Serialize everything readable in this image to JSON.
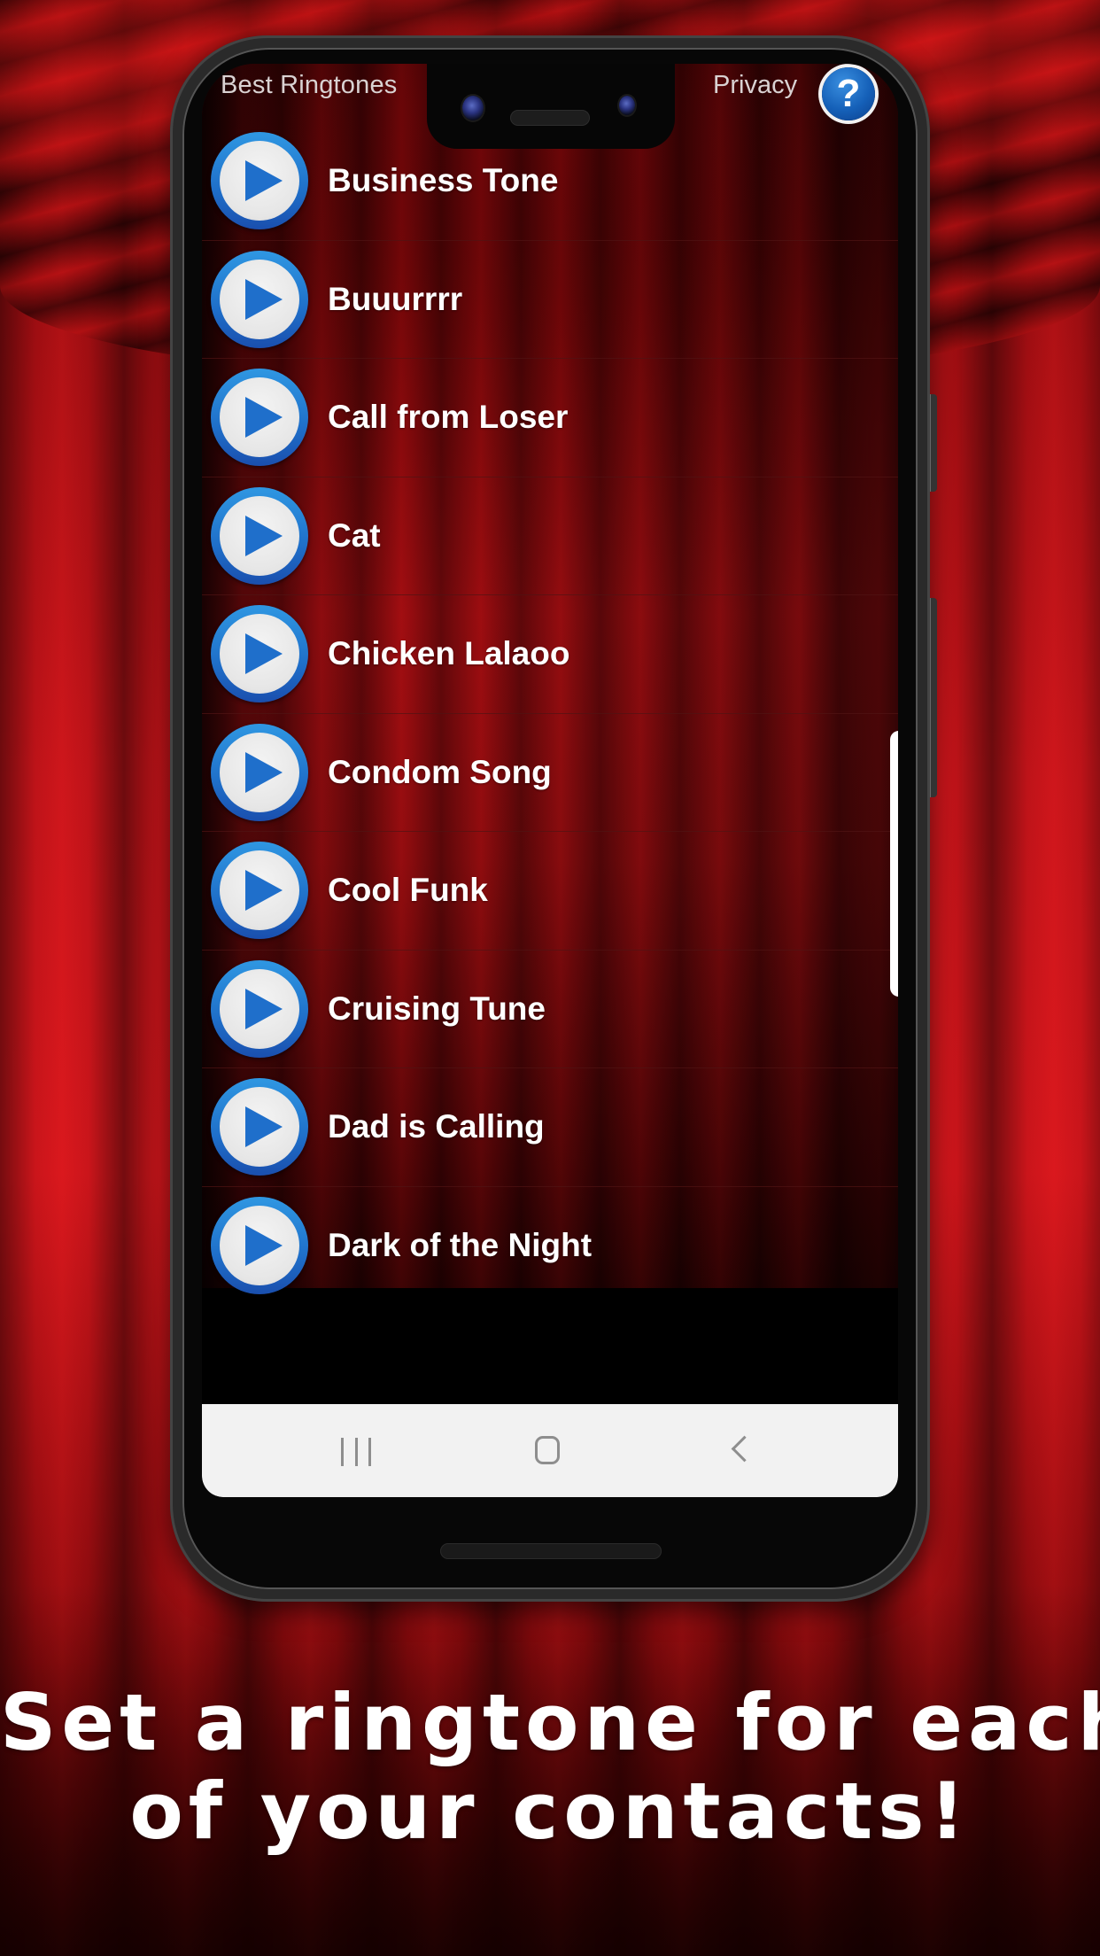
{
  "header": {
    "app_title": "Best Ringtones",
    "privacy_label": "Privacy",
    "help_icon": "?"
  },
  "ringtones": [
    {
      "name": "Business Tone"
    },
    {
      "name": "Buuurrrr"
    },
    {
      "name": "Call from Loser"
    },
    {
      "name": "Cat"
    },
    {
      "name": "Chicken Lalaoo"
    },
    {
      "name": "Condom Song"
    },
    {
      "name": "Cool Funk"
    },
    {
      "name": "Cruising Tune"
    },
    {
      "name": "Dad is Calling"
    },
    {
      "name": "Dark of the Night"
    }
  ],
  "nav_bar": {
    "recent_apps_icon": "recent-apps-icon",
    "home_icon": "home-icon",
    "back_icon": "back-icon"
  },
  "promo": {
    "line1": "Set a ringtone for each",
    "line2": "of your contacts!"
  },
  "colors": {
    "curtain_red": "#d5161c",
    "play_button_blue": "#1f6fcb",
    "nav_bar_bg": "#f2f2f2",
    "text_white": "#ffffff"
  }
}
